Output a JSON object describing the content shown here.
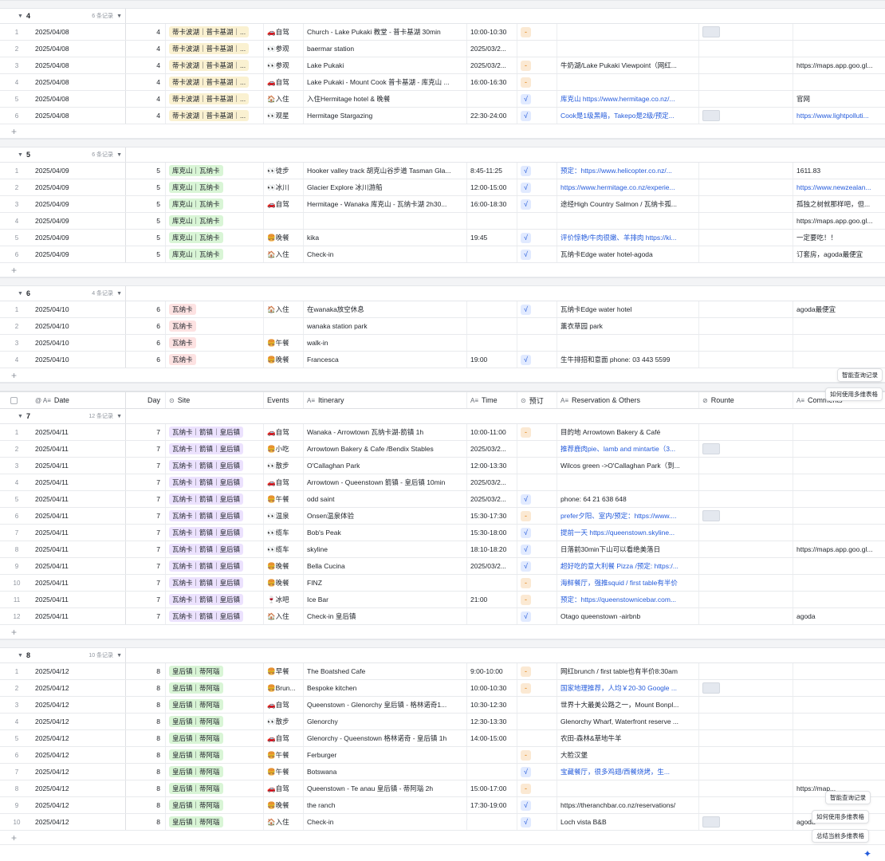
{
  "columns": {
    "date": "Date",
    "day": "Day",
    "site": "Site",
    "events": "Events",
    "itinerary": "Itinerary",
    "time": "Time",
    "prebook": "预订",
    "reservation": "Reservation & Others",
    "route": "Rounte",
    "comments": "Comments"
  },
  "floating": {
    "smart_query": "智能查询记录",
    "multi_table": "如何使用多维表格",
    "summarize": "总结当前多维表格"
  },
  "groups": [
    {
      "num": "4",
      "count": "6 条记录",
      "rows": [
        {
          "idx": "1",
          "date": "2025/04/08",
          "day": "4",
          "site": "蒂卡波湖｜普卡基湖｜...",
          "tag": "yellow",
          "event": "🚗自驾",
          "itin": "Church - Lake Pukaki 教堂 - 普卡基湖 30min",
          "time": "10:00-10:30",
          "pre": "dash",
          "res": "",
          "res_link": false,
          "route": "thumb",
          "comm": "",
          "comm_link": false
        },
        {
          "idx": "2",
          "date": "2025/04/08",
          "day": "4",
          "site": "蒂卡波湖｜普卡基湖｜...",
          "tag": "yellow",
          "event": "👀参观",
          "itin": "baermar station",
          "time": "2025/03/2...",
          "pre": "",
          "res": "",
          "res_link": false,
          "route": "",
          "comm": "",
          "comm_link": false
        },
        {
          "idx": "3",
          "date": "2025/04/08",
          "day": "4",
          "site": "蒂卡波湖｜普卡基湖｜...",
          "tag": "yellow",
          "event": "👀参观",
          "itin": "Lake Pukaki",
          "time": "2025/03/2...",
          "pre": "dash",
          "res": "牛奶湖/Lake Pukaki Viewpoint（网红...",
          "res_link": false,
          "route": "",
          "comm": "https://maps.app.goo.gl...",
          "comm_link": false
        },
        {
          "idx": "4",
          "date": "2025/04/08",
          "day": "4",
          "site": "蒂卡波湖｜普卡基湖｜...",
          "tag": "yellow",
          "event": "🚗自驾",
          "itin": "Lake Pukaki - Mount Cook 普卡基湖 - 库克山 ...",
          "time": "16:00-16:30",
          "pre": "dash",
          "res": "",
          "res_link": false,
          "route": "",
          "comm": "",
          "comm_link": false
        },
        {
          "idx": "5",
          "date": "2025/04/08",
          "day": "4",
          "site": "蒂卡波湖｜普卡基湖｜...",
          "tag": "yellow",
          "event": "🏠入住",
          "itin": "入住Hermitage hotel & 晚餐",
          "time": "",
          "pre": "check",
          "res": "库克山 https://www.hermitage.co.nz/...",
          "res_link": true,
          "route": "",
          "comm": "官网",
          "comm_link": false
        },
        {
          "idx": "6",
          "date": "2025/04/08",
          "day": "4",
          "site": "蒂卡波湖｜普卡基湖｜...",
          "tag": "yellow",
          "event": "👀观星",
          "itin": "Hermitage Stargazing",
          "time": "22:30-24:00",
          "pre": "check",
          "res": "Cook是1级黑暗，Takepo是2级/预定...",
          "res_link": true,
          "route": "thumb",
          "comm": "https://www.lightpolluti...",
          "comm_link": true
        }
      ]
    },
    {
      "num": "5",
      "count": "6 条记录",
      "rows": [
        {
          "idx": "1",
          "date": "2025/04/09",
          "day": "5",
          "site": "库克山｜瓦纳卡",
          "tag": "green",
          "event": "👀徒步",
          "itin": "Hooker valley track 胡克山谷步道 Tasman Gla...",
          "time": "8:45-11:25",
          "pre": "check",
          "res": "预定：https://www.helicopter.co.nz/...",
          "res_link": true,
          "route": "",
          "comm": "1611.83",
          "comm_link": false
        },
        {
          "idx": "2",
          "date": "2025/04/09",
          "day": "5",
          "site": "库克山｜瓦纳卡",
          "tag": "green",
          "event": "👀冰川",
          "itin": "Glacier Explore 冰川游船",
          "time": "12:00-15:00",
          "pre": "check",
          "res": "https://www.hermitage.co.nz/experie...",
          "res_link": true,
          "route": "",
          "comm": "https://www.newzealan...",
          "comm_link": true
        },
        {
          "idx": "3",
          "date": "2025/04/09",
          "day": "5",
          "site": "库克山｜瓦纳卡",
          "tag": "green",
          "event": "🚗自驾",
          "itin": "Hermitage - Wanaka 库克山 - 瓦纳卡湖 2h30...",
          "time": "16:00-18:30",
          "pre": "check",
          "res": "途经High Country Salmon / 瓦纳卡孤...",
          "res_link": false,
          "route": "",
          "comm": "孤独之树就那样吧，但...",
          "comm_link": false
        },
        {
          "idx": "4",
          "date": "2025/04/09",
          "day": "5",
          "site": "库克山｜瓦纳卡",
          "tag": "green",
          "event": "",
          "itin": "",
          "time": "",
          "pre": "",
          "res": "",
          "res_link": false,
          "route": "",
          "comm": "https://maps.app.goo.gl...",
          "comm_link": false
        },
        {
          "idx": "5",
          "date": "2025/04/09",
          "day": "5",
          "site": "库克山｜瓦纳卡",
          "tag": "green",
          "event": "🍔晚餐",
          "itin": "kika",
          "time": "19:45",
          "pre": "check",
          "res": "评价惊艳/牛肉很嫩、羊排肉 https://ki...",
          "res_link": true,
          "route": "",
          "comm": "一定要吃！！",
          "comm_link": false
        },
        {
          "idx": "6",
          "date": "2025/04/09",
          "day": "5",
          "site": "库克山｜瓦纳卡",
          "tag": "green",
          "event": "🏠入住",
          "itin": "Check-in",
          "time": "",
          "pre": "check",
          "res": "瓦纳卡Edge water hotel-agoda",
          "res_link": false,
          "route": "",
          "comm": "订套房，agoda最便宜",
          "comm_link": false
        }
      ]
    },
    {
      "num": "6",
      "count": "4 条记录",
      "rows": [
        {
          "idx": "1",
          "date": "2025/04/10",
          "day": "6",
          "site": "瓦纳卡",
          "tag": "red",
          "event": "🏠入住",
          "itin": "在wanaka放空休息",
          "time": "",
          "pre": "check",
          "res": "瓦纳卡Edge water hotel",
          "res_link": false,
          "route": "",
          "comm": "agoda最便宜",
          "comm_link": false
        },
        {
          "idx": "2",
          "date": "2025/04/10",
          "day": "6",
          "site": "瓦纳卡",
          "tag": "red",
          "event": "",
          "itin": "wanaka station park",
          "time": "",
          "pre": "",
          "res": "薰衣草园 park",
          "res_link": false,
          "route": "",
          "comm": "",
          "comm_link": false
        },
        {
          "idx": "3",
          "date": "2025/04/10",
          "day": "6",
          "site": "瓦纳卡",
          "tag": "red",
          "event": "🍔午餐",
          "itin": "walk-in",
          "time": "",
          "pre": "",
          "res": "",
          "res_link": false,
          "route": "",
          "comm": "",
          "comm_link": false
        },
        {
          "idx": "4",
          "date": "2025/04/10",
          "day": "6",
          "site": "瓦纳卡",
          "tag": "red",
          "event": "🍔晚餐",
          "itin": "Francesca",
          "time": "19:00",
          "pre": "check",
          "res": "生牛排招和意面 phone: 03 443 5599",
          "res_link": false,
          "route": "",
          "comm": "",
          "comm_link": false
        }
      ]
    },
    {
      "num": "7",
      "count": "12 条记录",
      "rows": [
        {
          "idx": "1",
          "date": "2025/04/11",
          "day": "7",
          "site": "瓦纳卡｜箭镇｜皇后镇",
          "tag": "purple",
          "event": "🚗自驾",
          "itin": "Wanaka - Arrowtown 瓦纳卡湖-箭镇 1h",
          "time": "10:00-11:00",
          "pre": "dash",
          "res": "目的地 Arrowtown Bakery & Café",
          "res_link": false,
          "route": "",
          "comm": "",
          "comm_link": false
        },
        {
          "idx": "2",
          "date": "2025/04/11",
          "day": "7",
          "site": "瓦纳卡｜箭镇｜皇后镇",
          "tag": "purple",
          "event": "🍔小吃",
          "itin": "Arrowtown Bakery & Cafe /Bendix Stables",
          "time": "2025/03/2...",
          "pre": "",
          "res": "推荐鹿肉pie、lamb and mintartie（3...",
          "res_link": true,
          "route": "thumb",
          "comm": "",
          "comm_link": false
        },
        {
          "idx": "3",
          "date": "2025/04/11",
          "day": "7",
          "site": "瓦纳卡｜箭镇｜皇后镇",
          "tag": "purple",
          "event": "👀散步",
          "itin": "O'Callaghan Park",
          "time": "12:00-13:30",
          "pre": "",
          "res": "Wilcos green ->O'Callaghan Park（到...",
          "res_link": false,
          "route": "",
          "comm": "",
          "comm_link": false
        },
        {
          "idx": "4",
          "date": "2025/04/11",
          "day": "7",
          "site": "瓦纳卡｜箭镇｜皇后镇",
          "tag": "purple",
          "event": "🚗自驾",
          "itin": "Arrowtown - Queenstown 箭镇 - 皇后镇 10min",
          "time": "2025/03/2...",
          "pre": "",
          "res": "",
          "res_link": false,
          "route": "",
          "comm": "",
          "comm_link": false
        },
        {
          "idx": "5",
          "date": "2025/04/11",
          "day": "7",
          "site": "瓦纳卡｜箭镇｜皇后镇",
          "tag": "purple",
          "event": "🍔午餐",
          "itin": "odd saint",
          "time": "2025/03/2...",
          "pre": "check",
          "res": "phone: 64 21 638 648",
          "res_link": false,
          "route": "",
          "comm": "",
          "comm_link": false
        },
        {
          "idx": "6",
          "date": "2025/04/11",
          "day": "7",
          "site": "瓦纳卡｜箭镇｜皇后镇",
          "tag": "purple",
          "event": "👀温泉",
          "itin": "Onsen温泉体验",
          "time": "15:30-17:30",
          "pre": "dash",
          "res": "prefer夕阳、室内/预定：https://www....",
          "res_link": true,
          "route": "thumb",
          "comm": "",
          "comm_link": false
        },
        {
          "idx": "7",
          "date": "2025/04/11",
          "day": "7",
          "site": "瓦纳卡｜箭镇｜皇后镇",
          "tag": "purple",
          "event": "👀缆车",
          "itin": "Bob's Peak",
          "time": "15:30-18:00",
          "pre": "check",
          "res": "提前一天 https://queenstown.skyline...",
          "res_link": true,
          "route": "",
          "comm": "",
          "comm_link": false
        },
        {
          "idx": "8",
          "date": "2025/04/11",
          "day": "7",
          "site": "瓦纳卡｜箭镇｜皇后镇",
          "tag": "purple",
          "event": "👀缆车",
          "itin": "skyline",
          "time": "18:10-18:20",
          "pre": "check",
          "res": "日落前30min下山可以看绝美落日",
          "res_link": false,
          "route": "",
          "comm": "https://maps.app.goo.gl...",
          "comm_link": false
        },
        {
          "idx": "9",
          "date": "2025/04/11",
          "day": "7",
          "site": "瓦纳卡｜箭镇｜皇后镇",
          "tag": "purple",
          "event": "🍔晚餐",
          "itin": "Bella Cucina",
          "time": "2025/03/2...",
          "pre": "check",
          "res": "超好吃的意大利餐 Pizza /预定: https:/...",
          "res_link": true,
          "route": "",
          "comm": "",
          "comm_link": false
        },
        {
          "idx": "10",
          "date": "2025/04/11",
          "day": "7",
          "site": "瓦纳卡｜箭镇｜皇后镇",
          "tag": "purple",
          "event": "🍔晚餐",
          "itin": "FINZ",
          "time": "",
          "pre": "dash",
          "res": "海鲜餐厅，强推squid / first table有半价",
          "res_link": true,
          "route": "",
          "comm": "",
          "comm_link": false
        },
        {
          "idx": "11",
          "date": "2025/04/11",
          "day": "7",
          "site": "瓦纳卡｜箭镇｜皇后镇",
          "tag": "purple",
          "event": "🍷冰吧",
          "itin": "Ice Bar",
          "time": "21:00",
          "pre": "dash",
          "res": "预定：https://queenstownicebar.com...",
          "res_link": true,
          "route": "",
          "comm": "",
          "comm_link": false
        },
        {
          "idx": "12",
          "date": "2025/04/11",
          "day": "7",
          "site": "瓦纳卡｜箭镇｜皇后镇",
          "tag": "purple",
          "event": "🏠入住",
          "itin": "Check-in 皇后镇",
          "time": "",
          "pre": "check",
          "res": "Otago queenstown -airbnb",
          "res_link": false,
          "route": "",
          "comm": "agoda",
          "comm_link": false
        }
      ]
    },
    {
      "num": "8",
      "count": "10 条记录",
      "rows": [
        {
          "idx": "1",
          "date": "2025/04/12",
          "day": "8",
          "site": "皇后镇｜蒂阿瑙",
          "tag": "green",
          "event": "🍔早餐",
          "itin": "The Boatshed Cafe",
          "time": "9:00-10:00",
          "pre": "dash",
          "res": "网红brunch / first table也有半价8:30am",
          "res_link": false,
          "route": "",
          "comm": "",
          "comm_link": false
        },
        {
          "idx": "2",
          "date": "2025/04/12",
          "day": "8",
          "site": "皇后镇｜蒂阿瑙",
          "tag": "green",
          "event": "🍔Brun...",
          "itin": "Bespoke kitchen",
          "time": "10:00-10:30",
          "pre": "dash",
          "res": "国家地理推荐，人均￥20-30 Google ...",
          "res_link": true,
          "route": "thumb",
          "comm": "",
          "comm_link": false
        },
        {
          "idx": "3",
          "date": "2025/04/12",
          "day": "8",
          "site": "皇后镇｜蒂阿瑙",
          "tag": "green",
          "event": "🚗自驾",
          "itin": "Queenstown - Glenorchy 皇后镇 - 格林诺奇1...",
          "time": "10:30-12:30",
          "pre": "",
          "res": "世界十大最美公路之一，Mount Bonpl...",
          "res_link": false,
          "route": "",
          "comm": "",
          "comm_link": false
        },
        {
          "idx": "4",
          "date": "2025/04/12",
          "day": "8",
          "site": "皇后镇｜蒂阿瑙",
          "tag": "green",
          "event": "👀散步",
          "itin": "Glenorchy",
          "time": "12:30-13:30",
          "pre": "",
          "res": "Glenorchy Wharf, Waterfront reserve ...",
          "res_link": false,
          "route": "",
          "comm": "",
          "comm_link": false
        },
        {
          "idx": "5",
          "date": "2025/04/12",
          "day": "8",
          "site": "皇后镇｜蒂阿瑙",
          "tag": "green",
          "event": "🚗自驾",
          "itin": "Glenorchy - Queenstown 格林诺奇 - 皇后镇 1h",
          "time": "14:00-15:00",
          "pre": "",
          "res": "农田-森林&草地牛羊",
          "res_link": false,
          "route": "",
          "comm": "",
          "comm_link": false
        },
        {
          "idx": "6",
          "date": "2025/04/12",
          "day": "8",
          "site": "皇后镇｜蒂阿瑙",
          "tag": "green",
          "event": "🍔午餐",
          "itin": "Ferburger",
          "time": "",
          "pre": "dash",
          "res": "大脸汉堡",
          "res_link": false,
          "route": "",
          "comm": "",
          "comm_link": false
        },
        {
          "idx": "7",
          "date": "2025/04/12",
          "day": "8",
          "site": "皇后镇｜蒂阿瑙",
          "tag": "green",
          "event": "🍔午餐",
          "itin": "Botswana",
          "time": "",
          "pre": "check",
          "res": "宝藏餐厅，很多鸡翅/西餐烧烤，生...",
          "res_link": true,
          "route": "",
          "comm": "",
          "comm_link": false
        },
        {
          "idx": "8",
          "date": "2025/04/12",
          "day": "8",
          "site": "皇后镇｜蒂阿瑙",
          "tag": "green",
          "event": "🚗自驾",
          "itin": "Queenstown - Te anau 皇后镇 - 蒂阿瑙 2h",
          "time": "15:00-17:00",
          "pre": "dash",
          "res": "",
          "res_link": false,
          "route": "",
          "comm": "https://map...",
          "comm_link": false
        },
        {
          "idx": "9",
          "date": "2025/04/12",
          "day": "8",
          "site": "皇后镇｜蒂阿瑙",
          "tag": "green",
          "event": "🍔晚餐",
          "itin": "the ranch",
          "time": "17:30-19:00",
          "pre": "check",
          "res": "https://theranchbar.co.nz/reservations/",
          "res_link": false,
          "route": "",
          "comm": "",
          "comm_link": false
        },
        {
          "idx": "10",
          "date": "2025/04/12",
          "day": "8",
          "site": "皇后镇｜蒂阿瑙",
          "tag": "green",
          "event": "🏠入住",
          "itin": "Check-in",
          "time": "",
          "pre": "check",
          "res": "Loch vista B&B",
          "res_link": false,
          "route": "thumb",
          "comm": "agoda",
          "comm_link": false
        }
      ]
    }
  ]
}
